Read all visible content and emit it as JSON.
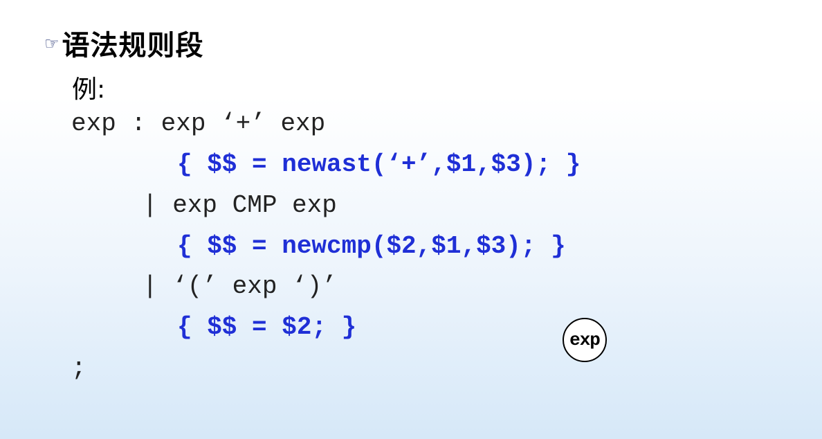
{
  "slide": {
    "bullet_icon": "pointing-hand-icon",
    "title": "语法规则段",
    "example_label": "例:"
  },
  "code": {
    "line1": "exp : exp ‘+’ exp",
    "line2": "{ $$ = newast(‘+’,$1,$3); }",
    "line3": "| exp CMP exp",
    "line4": "{ $$ = newcmp($2,$1,$3); }",
    "line5": "| ‘(’ exp ‘)’",
    "line6": "{ $$ = $2; }",
    "line7": ";"
  },
  "colors": {
    "action_text": "#1f2fd6",
    "rule_text": "#222222",
    "title_text": "#000000"
  },
  "tree_node": {
    "label": "exp"
  }
}
